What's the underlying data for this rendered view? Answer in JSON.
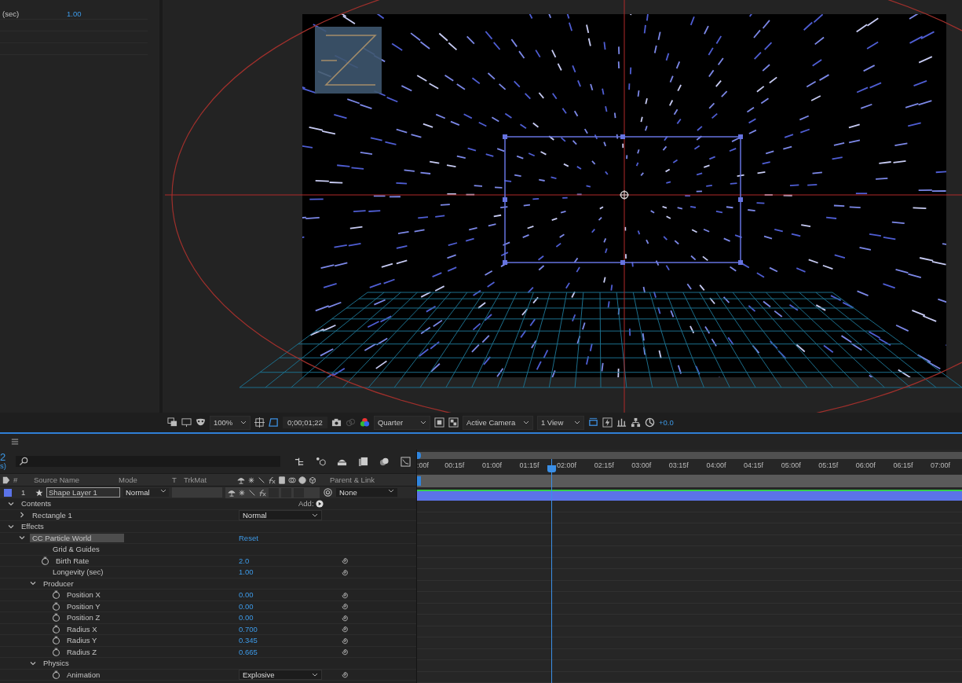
{
  "left_panel": {
    "rows": [
      {
        "label": "(sec)",
        "value": "1.00"
      }
    ]
  },
  "viewer": {
    "toolbar": {
      "zoom": "100%",
      "timecode": "0;00;01;22",
      "resolution": "Quarter",
      "camera": "Active Camera",
      "views": "1 View",
      "exposure": "+0.0"
    }
  },
  "timeline": {
    "edge_fragments": [
      "2",
      "s)"
    ],
    "columns": {
      "number": "#",
      "source_name": "Source Name",
      "mode": "Mode",
      "t": "T",
      "trkmat": "TrkMat",
      "parent": "Parent & Link"
    },
    "layer": {
      "number": "1",
      "name": "Shape Layer 1",
      "mode": "Normal",
      "parent": "None",
      "color": "#5b73e8"
    },
    "properties": [
      {
        "label": "Contents",
        "expanded": true,
        "selected": false,
        "kind": "add",
        "value": "Add:",
        "children": [
          {
            "label": "Rectangle 1",
            "expanded": false,
            "selected": false,
            "kind": "dropdown",
            "value": "Normal"
          }
        ]
      },
      {
        "label": "Effects",
        "expanded": true,
        "selected": false,
        "children": [
          {
            "label": "CC Particle World",
            "expanded": true,
            "selected": true,
            "kind": "link",
            "value": "Reset",
            "children": [
              {
                "label": "Grid & Guides",
                "selected": false
              },
              {
                "label": "Birth Rate",
                "selected": false,
                "stopwatch": true,
                "kind": "value",
                "value": "2.0",
                "expression": true
              },
              {
                "label": "Longevity (sec)",
                "selected": false,
                "kind": "value",
                "value": "1.00",
                "expression": true
              },
              {
                "label": "Producer",
                "expanded": true,
                "selected": false,
                "children": [
                  {
                    "label": "Position X",
                    "selected": false,
                    "stopwatch": true,
                    "kind": "value",
                    "value": "0.00",
                    "expression": true
                  },
                  {
                    "label": "Position Y",
                    "selected": false,
                    "stopwatch": true,
                    "kind": "value",
                    "value": "0.00",
                    "expression": true
                  },
                  {
                    "label": "Position Z",
                    "selected": false,
                    "stopwatch": true,
                    "kind": "value",
                    "value": "0.00",
                    "expression": true
                  },
                  {
                    "label": "Radius X",
                    "selected": false,
                    "stopwatch": true,
                    "kind": "value",
                    "value": "0.700",
                    "expression": true
                  },
                  {
                    "label": "Radius Y",
                    "selected": false,
                    "stopwatch": true,
                    "kind": "value",
                    "value": "0.345",
                    "expression": true
                  },
                  {
                    "label": "Radius Z",
                    "selected": false,
                    "stopwatch": true,
                    "kind": "value",
                    "value": "0.665",
                    "expression": true
                  }
                ]
              },
              {
                "label": "Physics",
                "expanded": true,
                "selected": false,
                "children": [
                  {
                    "label": "Animation",
                    "selected": false,
                    "stopwatch": true,
                    "kind": "dropdown",
                    "value": "Explosive",
                    "expression": true
                  }
                ]
              }
            ]
          }
        ]
      }
    ],
    "ruler": [
      ":00f",
      "00:15f",
      "01:00f",
      "01:15f",
      "02:00f",
      "02:15f",
      "03:00f",
      "03:15f",
      "04:00f",
      "04:15f",
      "05:00f",
      "05:15f",
      "06:00f",
      "06:15f",
      "07:00f"
    ]
  }
}
